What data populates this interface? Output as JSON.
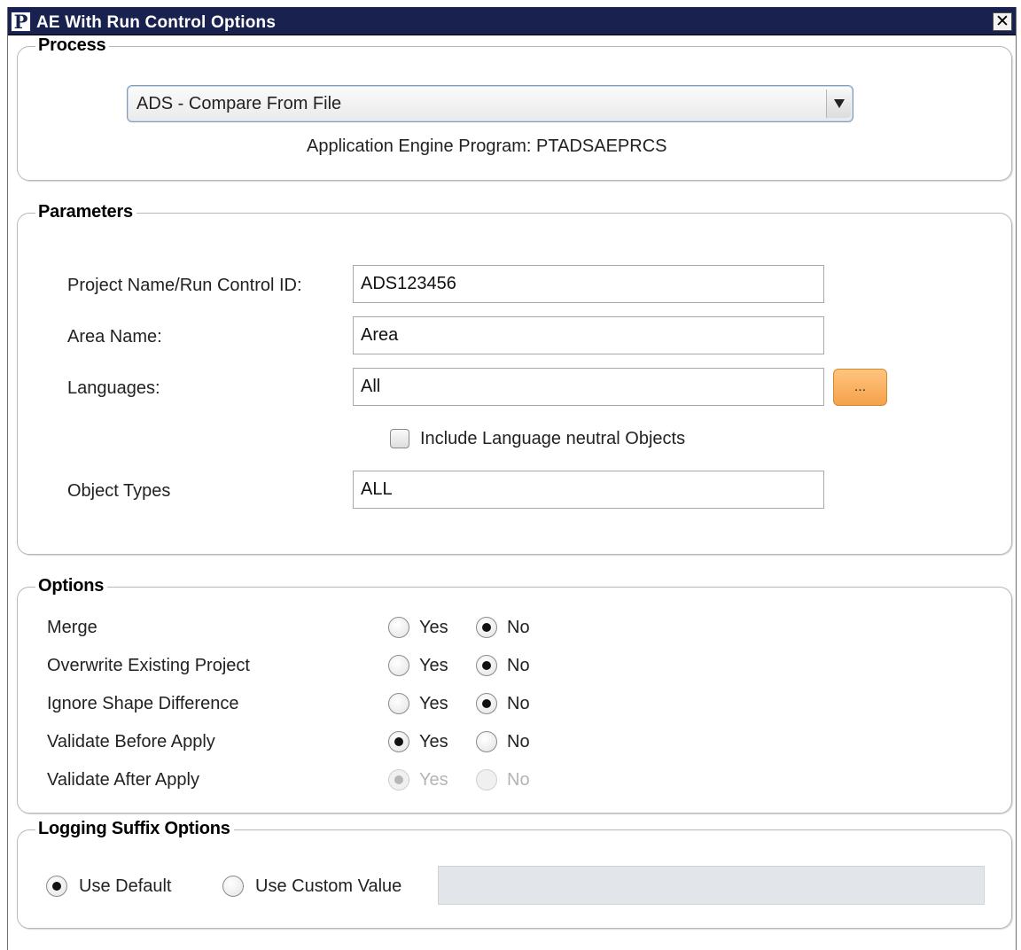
{
  "window": {
    "title": "AE With Run Control Options",
    "icon_letter": "P",
    "close_label": "✕"
  },
  "process": {
    "legend": "Process",
    "selected": "ADS - Compare From File",
    "program_text": "Application Engine Program: PTADSAEPRCS"
  },
  "parameters": {
    "legend": "Parameters",
    "project_label": "Project Name/Run Control ID:",
    "project_value": "ADS123456",
    "area_label": "Area Name:",
    "area_value": "Area",
    "languages_label": "Languages:",
    "languages_value": "All",
    "browse_label": "...",
    "include_neutral_label": "Include Language neutral Objects",
    "include_neutral_checked": false,
    "object_types_label": "Object Types",
    "object_types_value": "ALL"
  },
  "options": {
    "legend": "Options",
    "yes_label": "Yes",
    "no_label": "No",
    "rows": [
      {
        "label": "Merge",
        "value": "No",
        "disabled": false
      },
      {
        "label": "Overwrite Existing Project",
        "value": "No",
        "disabled": false
      },
      {
        "label": "Ignore Shape Difference",
        "value": "No",
        "disabled": false
      },
      {
        "label": "Validate Before Apply",
        "value": "Yes",
        "disabled": false
      },
      {
        "label": "Validate After Apply",
        "value": "Yes",
        "disabled": true
      }
    ]
  },
  "logging": {
    "legend": "Logging Suffix Options",
    "default_label": "Use Default",
    "custom_label": "Use Custom Value",
    "selected": "Use Default",
    "custom_value": ""
  }
}
